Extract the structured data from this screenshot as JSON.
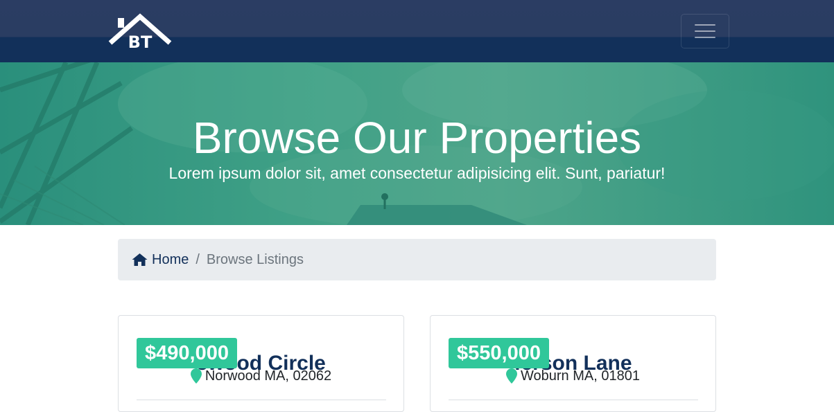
{
  "navbar": {
    "logo_text": "BT",
    "menu_icon": "hamburger-icon"
  },
  "hero": {
    "title": "Browse Our Properties",
    "subtitle": "Lorem ipsum dolor sit, amet consectetur adipisicing elit. Sunt, pariatur!"
  },
  "breadcrumb": {
    "home_icon": "home-icon",
    "home_label": "Home",
    "separator": "/",
    "current_label": "Browse Listings"
  },
  "listings": [
    {
      "price": "$490,000",
      "title_visible": "ewood Circle",
      "location": "Norwood MA, 02062",
      "location_icon": "map-marker-icon"
    },
    {
      "price": "$550,000",
      "title_visible": "ferson Lane",
      "location": "Woburn MA, 01801",
      "location_icon": "map-marker-icon"
    }
  ],
  "colors": {
    "navy": "#12305a",
    "teal": "#30c79a",
    "breadcrumb_bg": "#e9ecef"
  }
}
